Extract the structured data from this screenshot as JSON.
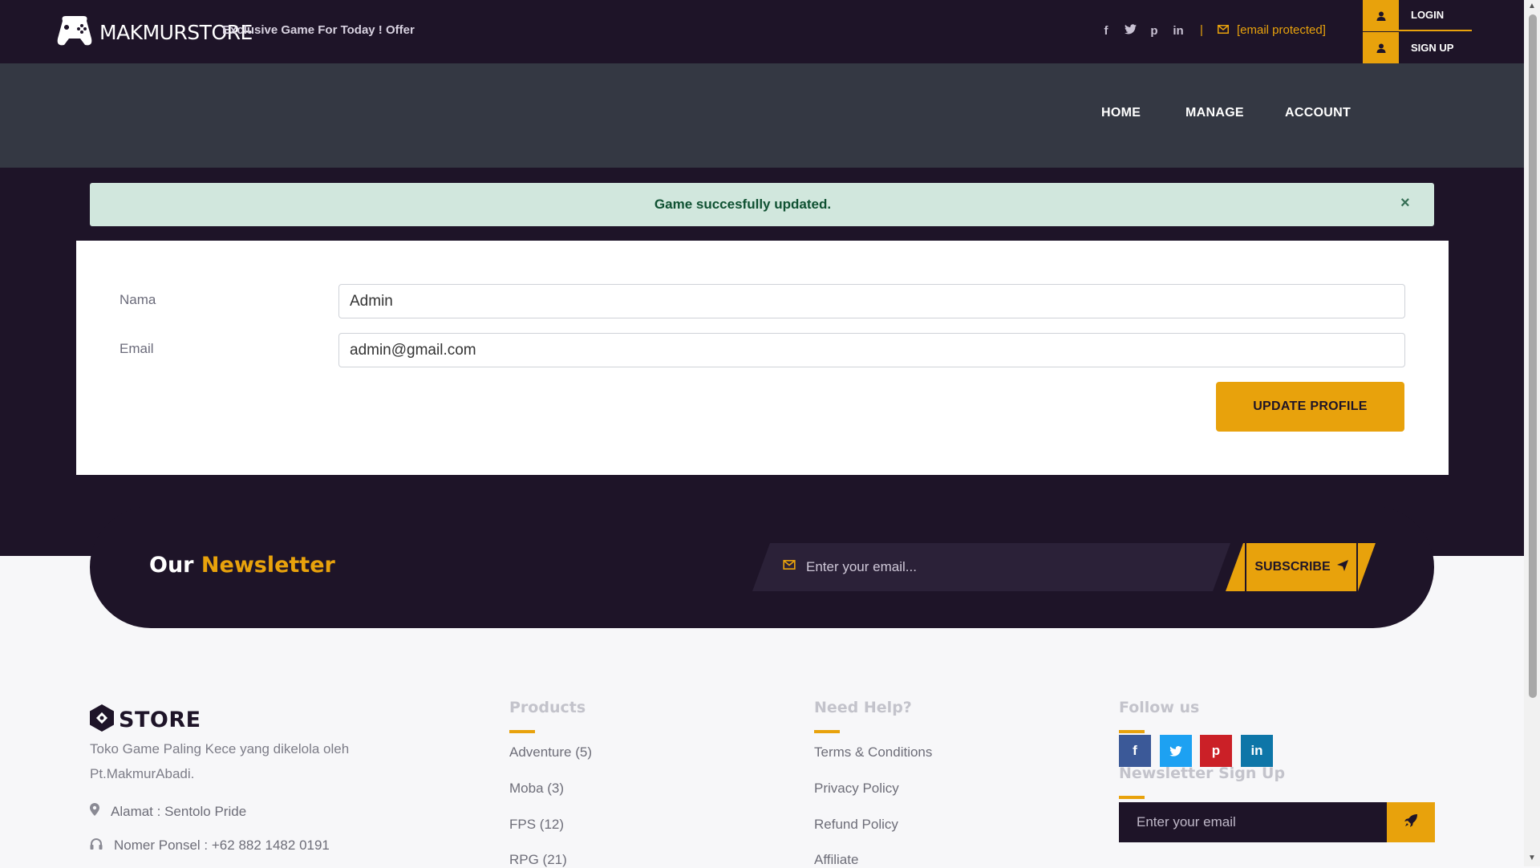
{
  "header": {
    "brand": "MAKMURSTORE",
    "tagline": "Exclusive Game For Today ! Offer",
    "social_icons": [
      "facebook-icon",
      "twitter-icon",
      "pinterest-icon",
      "linkedin-icon"
    ],
    "separator": "|",
    "email": "[email protected]",
    "login_label": "LOGIN",
    "signup_label": "SIGN UP"
  },
  "nav": {
    "home": "HOME",
    "manage": "MANAGE",
    "account": "ACCOUNT"
  },
  "alert": {
    "message": "Game succesfully updated.",
    "close": "×"
  },
  "form": {
    "name_label": "Nama",
    "name_value": "Admin",
    "email_label": "Email",
    "email_value": "admin@gmail.com",
    "submit_label": "UPDATE PROFILE"
  },
  "newsletter": {
    "title_prefix": "Our",
    "title_accent": "Newsletter",
    "placeholder": "Enter your email...",
    "subscribe_label": "SUBSCRIBE"
  },
  "footer": {
    "logo_text": "STORE",
    "description": "Toko Game Paling Kece yang dikelola oleh Pt.MakmurAbadi.",
    "address": "Alamat : Sentolo Pride",
    "phone": "Nomer Ponsel : +62 882 1482 0191",
    "products": {
      "title": "Products",
      "items": [
        "Adventure (5)",
        "Moba (3)",
        "FPS (12)",
        "RPG (21)"
      ]
    },
    "help": {
      "title": "Need Help?",
      "items": [
        "Terms & Conditions",
        "Privacy Policy",
        "Refund Policy",
        "Affiliate"
      ]
    },
    "follow": {
      "title": "Follow us",
      "icons": [
        "facebook-icon",
        "twitter-icon",
        "pinterest-icon",
        "linkedin-icon"
      ]
    },
    "newsletter_signup": {
      "title": "Newsletter Sign Up",
      "placeholder": "Enter your email"
    }
  },
  "colors": {
    "dark": "#1e1428",
    "nav": "#343843",
    "accent": "#e8a20c",
    "alert_bg": "#d1e7dd",
    "alert_text": "#0f5132",
    "facebook": "#3b5998",
    "twitter": "#1da1f2",
    "pinterest": "#cb2027",
    "linkedin": "#0e76a8"
  }
}
